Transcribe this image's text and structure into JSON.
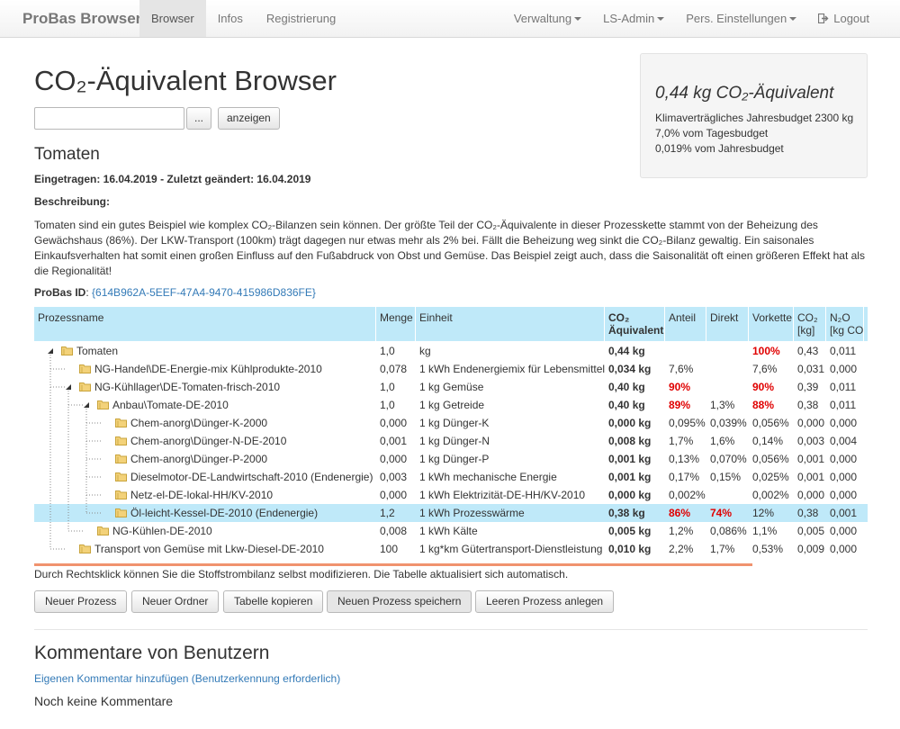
{
  "navbar": {
    "brand": "ProBas Browser",
    "left": [
      "Browser",
      "Infos",
      "Registrierung"
    ],
    "right": [
      "Verwaltung",
      "LS-Admin",
      "Pers. Einstellungen"
    ],
    "logout": "Logout"
  },
  "page": {
    "title": "CO₂-Äquivalent Browser",
    "search_button": "...",
    "show_button": "anzeigen"
  },
  "summary": {
    "main": "0,44 kg CO₂-Äquivalent",
    "line1": "Klimaverträgliches Jahresbudget 2300 kg",
    "line2": "7,0% vom Tagesbudget",
    "line3": "0,019% vom Jahresbudget"
  },
  "product": {
    "name": "Tomaten",
    "dates": "Eingetragen: 16.04.2019 - Zuletzt geändert: 16.04.2019",
    "desc_label": "Beschreibung:",
    "description": "Tomaten sind ein gutes Beispiel wie komplex CO₂-Bilanzen sein können. Der größte Teil der CO₂-Äquivalente in dieser Prozesskette stammt von der Beheizung des Gewächshaus (86%). Der LKW-Transport (100km) trägt dagegen nur etwas mehr als 2% bei. Fällt die Beheizung weg sinkt die CO₂-Bilanz gewaltig. Ein saisonales Einkaufsverhalten hat somit einen großen Einfluss auf den Fußabdruck von Obst und Gemüse. Das Beispiel zeigt auch, dass die Saisonalität oft einen größeren Effekt hat als die Regionalität!",
    "id_label": "ProBas ID",
    "id_value": "{614B962A-5EEF-47A4-9470-415986D836FE}"
  },
  "table": {
    "headers": {
      "name": "Prozessname",
      "menge": "Menge",
      "einheit": "Einheit",
      "co2aeq_1": "CO₂",
      "co2aeq_2": "Äquivalent",
      "anteil": "Anteil",
      "direkt": "Direkt",
      "vorkette": "Vorkette",
      "co2_1": "CO₂",
      "co2_2": "[kg]",
      "n2o_1": "N₂O",
      "n2o_2": "[kg CO"
    },
    "rows": [
      {
        "name": "Tomaten",
        "menge": "1,0",
        "einheit": "kg",
        "co2aeq": "0,44 kg",
        "anteil": "",
        "direkt": "",
        "vorkette": "100%",
        "co2": "0,43",
        "n2o": "0,011"
      },
      {
        "name": "NG-Handel\\DE-Energie-mix Kühlprodukte-2010",
        "menge": "0,078",
        "einheit": "1 kWh Endenergiemix für Lebensmittel",
        "co2aeq": "0,034 kg",
        "anteil": "7,6%",
        "direkt": "",
        "vorkette": "7,6%",
        "co2": "0,031",
        "n2o": "0,000"
      },
      {
        "name": "NG-Kühllager\\DE-Tomaten-frisch-2010",
        "menge": "1,0",
        "einheit": "1 kg Gemüse",
        "co2aeq": "0,40 kg",
        "anteil": "90%",
        "direkt": "",
        "vorkette": "90%",
        "co2": "0,39",
        "n2o": "0,011"
      },
      {
        "name": "Anbau\\Tomate-DE-2010",
        "menge": "1,0",
        "einheit": "1 kg Getreide",
        "co2aeq": "0,40 kg",
        "anteil": "89%",
        "direkt": "1,3%",
        "vorkette": "88%",
        "co2": "0,38",
        "n2o": "0,011"
      },
      {
        "name": "Chem-anorg\\Dünger-K-2000",
        "menge": "0,000",
        "einheit": "1 kg Dünger-K",
        "co2aeq": "0,000 kg",
        "anteil": "0,095%",
        "direkt": "0,039%",
        "vorkette": "0,056%",
        "co2": "0,000",
        "n2o": "0,000"
      },
      {
        "name": "Chem-anorg\\Dünger-N-DE-2010",
        "menge": "0,001",
        "einheit": "1 kg Dünger-N",
        "co2aeq": "0,008 kg",
        "anteil": "1,7%",
        "direkt": "1,6%",
        "vorkette": "0,14%",
        "co2": "0,003",
        "n2o": "0,004"
      },
      {
        "name": "Chem-anorg\\Dünger-P-2000",
        "menge": "0,000",
        "einheit": "1 kg Dünger-P",
        "co2aeq": "0,001 kg",
        "anteil": "0,13%",
        "direkt": "0,070%",
        "vorkette": "0,056%",
        "co2": "0,001",
        "n2o": "0,000"
      },
      {
        "name": "Dieselmotor-DE-Landwirtschaft-2010 (Endenergie)",
        "menge": "0,003",
        "einheit": "1 kWh mechanische Energie",
        "co2aeq": "0,001 kg",
        "anteil": "0,17%",
        "direkt": "0,15%",
        "vorkette": "0,025%",
        "co2": "0,001",
        "n2o": "0,000"
      },
      {
        "name": "Netz-el-DE-lokal-HH/KV-2010",
        "menge": "0,000",
        "einheit": "1 kWh Elektrizität-DE-HH/KV-2010",
        "co2aeq": "0,000 kg",
        "anteil": "0,002%",
        "direkt": "",
        "vorkette": "0,002%",
        "co2": "0,000",
        "n2o": "0,000"
      },
      {
        "name": "Öl-leicht-Kessel-DE-2010 (Endenergie)",
        "menge": "1,2",
        "einheit": "1 kWh Prozesswärme",
        "co2aeq": "0,38 kg",
        "anteil": "86%",
        "direkt": "74%",
        "vorkette": "12%",
        "co2": "0,38",
        "n2o": "0,001"
      },
      {
        "name": "NG-Kühlen-DE-2010",
        "menge": "0,008",
        "einheit": "1 kWh Kälte",
        "co2aeq": "0,005 kg",
        "anteil": "1,2%",
        "direkt": "0,086%",
        "vorkette": "1,1%",
        "co2": "0,005",
        "n2o": "0,000"
      },
      {
        "name": "Transport von Gemüse mit Lkw-Diesel-DE-2010",
        "menge": "100",
        "einheit": "1 kg*km Gütertransport-Dienstleistung",
        "co2aeq": "0,010 kg",
        "anteil": "2,2%",
        "direkt": "1,7%",
        "vorkette": "0,53%",
        "co2": "0,009",
        "n2o": "0,000"
      }
    ]
  },
  "hint": "Durch Rechtsklick können Sie die Stoffstrombilanz selbst modifizieren. Die Tabelle aktualisiert sich automatisch.",
  "actions": [
    "Neuer Prozess",
    "Neuer Ordner",
    "Tabelle kopieren",
    "Neuen Prozess speichern",
    "Leeren Prozess anlegen"
  ],
  "comments": {
    "title": "Kommentare von Benutzern",
    "add_link": "Eigenen Kommentar hinzufügen (Benutzerkennung erforderlich)",
    "none": "Noch keine Kommentare"
  },
  "colors": {
    "accent_link": "#337ab7",
    "table_header_bg": "#bfe9f9",
    "highlight_red": "#e00000",
    "scroll_indicator": "#f0926e"
  }
}
